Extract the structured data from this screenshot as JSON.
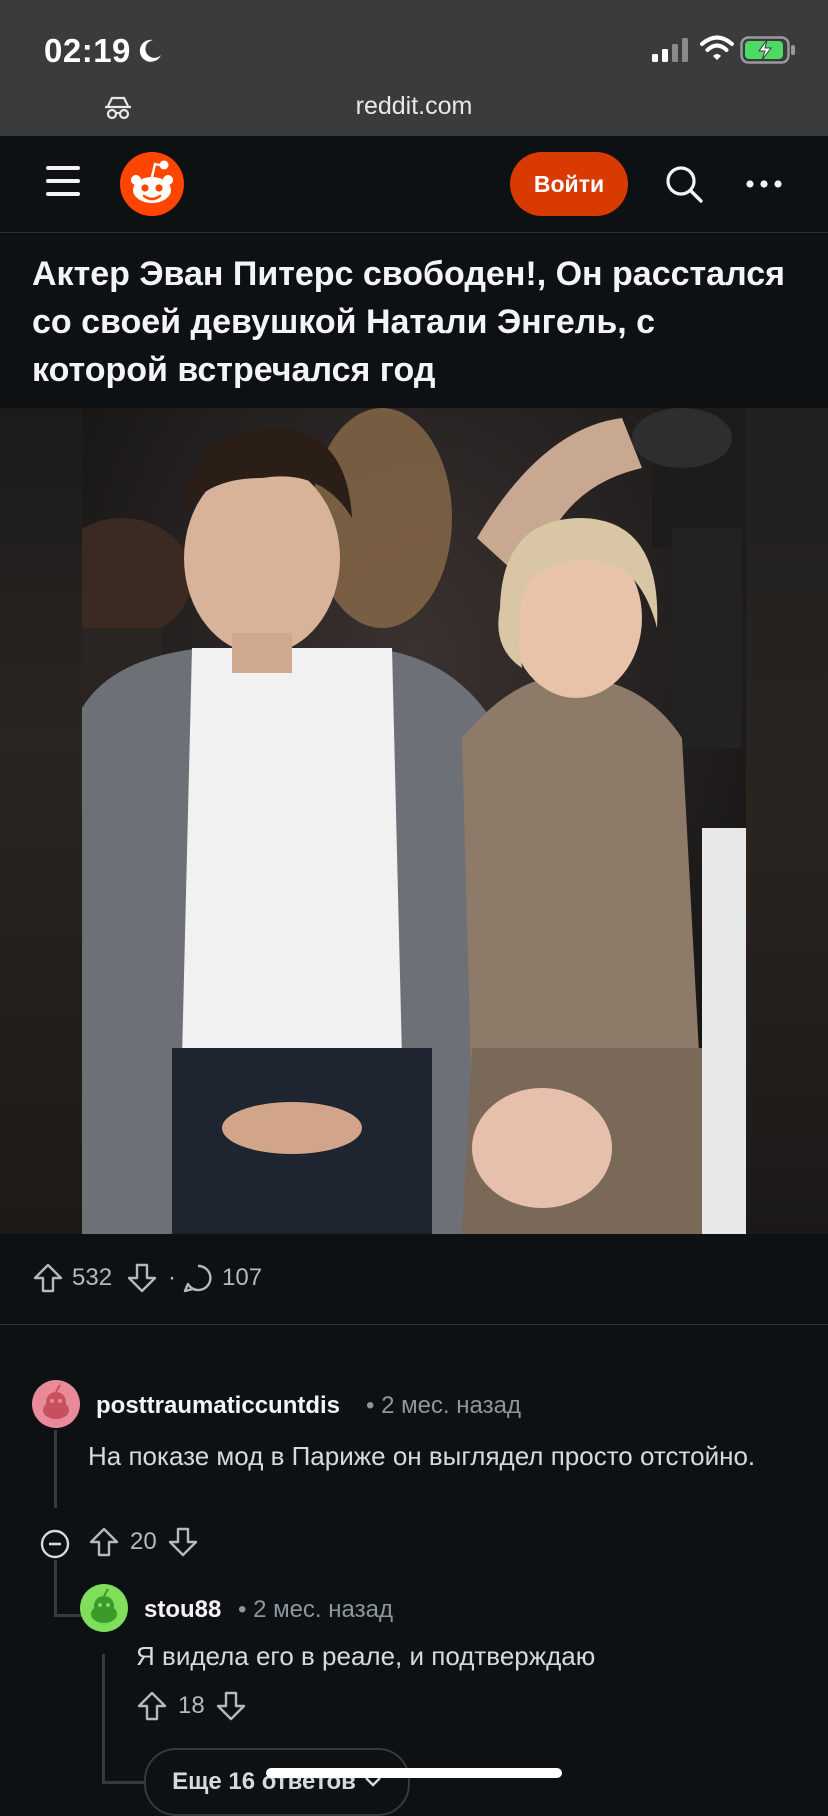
{
  "status_bar": {
    "time": "02:19"
  },
  "browser": {
    "url": "reddit.com"
  },
  "header": {
    "login_label": "Войти"
  },
  "post": {
    "title": "Актер Эван Питерс свободен!, Он расстался со своей девушкой Натали Энгель, с которой встречался год",
    "score": "532",
    "separator": "·",
    "comments_count": "107"
  },
  "comments": [
    {
      "user": "posttraumaticcuntdis",
      "meta": "• 2 мес. назад",
      "body": "На показе мод в Париже он выглядел просто отстойно.",
      "score": "20",
      "avatar_color": "#e88a9a"
    },
    {
      "user": "stou88",
      "meta": "• 2 мес. назад",
      "body": "Я видела его в реале, и подтверждаю",
      "score": "18",
      "avatar_color": "#7ee05a"
    }
  ],
  "more_replies_label": "Еще 16 ответов",
  "colors": {
    "accent": "#d93a00",
    "background": "#0e1113",
    "browser_bar": "#3a3b3d"
  },
  "icons": [
    "moon-icon",
    "signal-icon",
    "wifi-icon",
    "battery-icon",
    "incognito-icon",
    "menu-icon",
    "reddit-logo-icon",
    "search-icon",
    "more-icon",
    "upvote-icon",
    "downvote-icon",
    "comment-icon",
    "collapse-icon",
    "chevron-down-icon"
  ]
}
